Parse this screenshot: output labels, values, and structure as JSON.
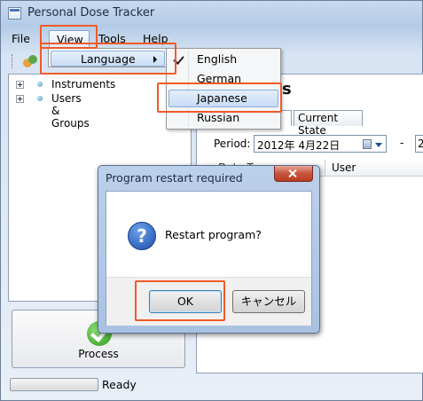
{
  "window": {
    "title": "Personal Dose Tracker"
  },
  "menubar": {
    "file": "File",
    "view": "View",
    "tools": "Tools",
    "help": "Help"
  },
  "view_menu": {
    "language": "Language"
  },
  "language_submenu": {
    "items": [
      "English",
      "German",
      "Japanese",
      "Russian"
    ],
    "checked": "English",
    "hovered": "Japanese"
  },
  "tree": {
    "items": [
      "Instruments",
      "Users & Groups"
    ]
  },
  "right_panel": {
    "heading_fragment": "s",
    "tabs": [
      "y",
      "Current State"
    ],
    "period_label": "Period:",
    "date_from": "2012年  4月22日",
    "date_separator": "-",
    "date_to_fragment": "2",
    "grid_headers": [
      "Date T...",
      "User"
    ]
  },
  "process_button": {
    "label": "Process"
  },
  "status": {
    "text": "Ready"
  },
  "dialog": {
    "title": "Program restart required",
    "message": "Restart program?",
    "ok": "OK",
    "cancel": "キャンセル",
    "icon": "question-icon"
  },
  "colors": {
    "highlight": "#f05a28",
    "accent": "#3c7fb1"
  }
}
